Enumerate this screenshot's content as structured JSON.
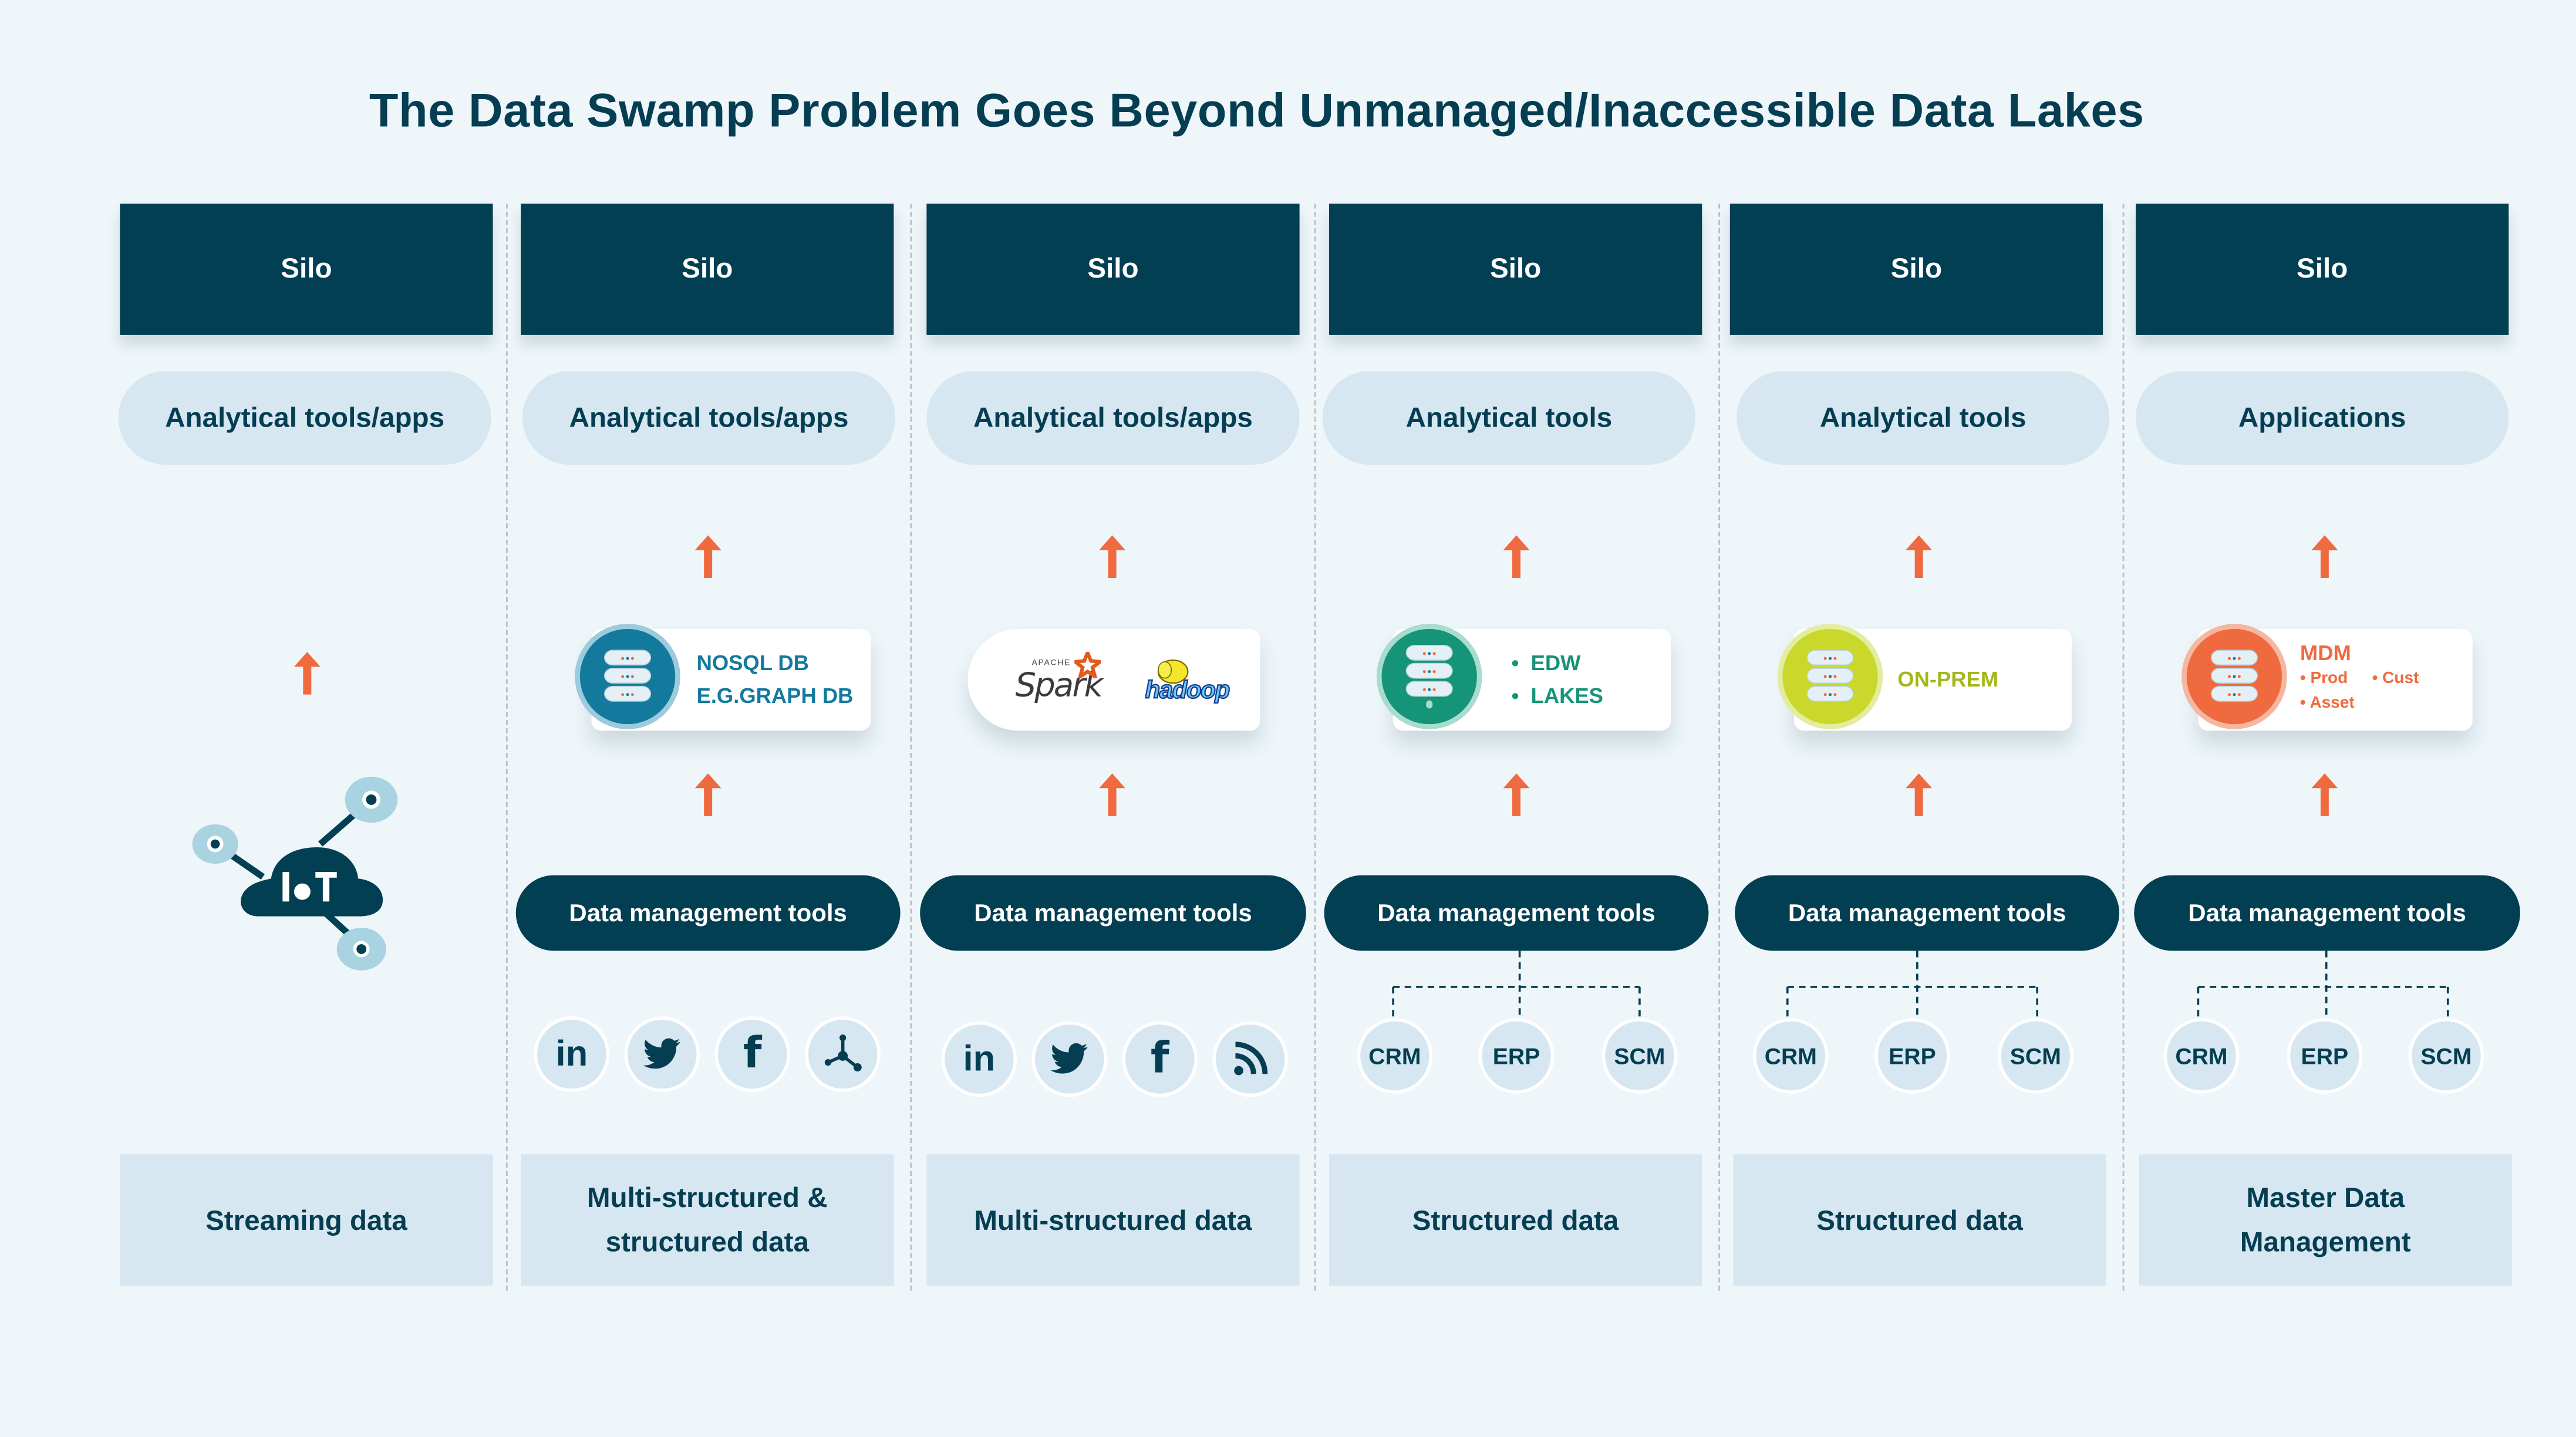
{
  "title": "The Data Swamp Problem Goes Beyond Unmanaged/Inaccessible Data Lakes",
  "colors": {
    "navy": "#033f53",
    "light_blue": "#d6e7f1",
    "background": "#eef6fa",
    "arrow_orange": "#f06a3f",
    "nosql_blue": "#137a9e",
    "edw_green": "#159477",
    "onprem_lime": "#c9d82b",
    "mdm_orange": "#f06a3f"
  },
  "columns": [
    {
      "silo": "Silo",
      "tool": "Analytical tools/apps",
      "source": "iot-cloud-icon",
      "source_label": "IoT",
      "bottom": "Streaming data"
    },
    {
      "silo": "Silo",
      "tool": "Analytical tools/apps",
      "store": {
        "lines": [
          "NOSQL DB",
          "E.G.GRAPH DB"
        ]
      },
      "data_mgmt": "Data management tools",
      "sources": [
        "linkedin-icon",
        "twitter-icon",
        "facebook-icon",
        "graph-network-icon"
      ],
      "bottom": "Multi-structured & structured data"
    },
    {
      "silo": "Silo",
      "tool": "Analytical tools/apps",
      "store": {
        "logos": [
          "Apache Spark",
          "hadoop"
        ],
        "spark_small": "APACHE",
        "spark_word": "Spark",
        "hadoop_word": "hadoop"
      },
      "data_mgmt": "Data management tools",
      "sources": [
        "linkedin-icon",
        "twitter-icon",
        "facebook-icon",
        "rss-feed-icon"
      ],
      "bottom": "Multi-structured data"
    },
    {
      "silo": "Silo",
      "tool": "Analytical tools",
      "store": {
        "bullets": [
          "EDW",
          "LAKES"
        ]
      },
      "data_mgmt": "Data management tools",
      "systems": [
        "CRM",
        "ERP",
        "SCM"
      ],
      "bottom": "Structured data"
    },
    {
      "silo": "Silo",
      "tool": "Analytical tools",
      "store": {
        "lines": [
          "ON-PREM"
        ]
      },
      "data_mgmt": "Data management tools",
      "systems": [
        "CRM",
        "ERP",
        "SCM"
      ],
      "bottom": "Structured data"
    },
    {
      "silo": "Silo",
      "tool": "Applications",
      "store": {
        "heading": "MDM",
        "bullets": [
          "Prod",
          "Cust",
          "Asset"
        ]
      },
      "data_mgmt": "Data management tools",
      "systems": [
        "CRM",
        "ERP",
        "SCM"
      ],
      "bottom": "Master Data Management"
    }
  ]
}
